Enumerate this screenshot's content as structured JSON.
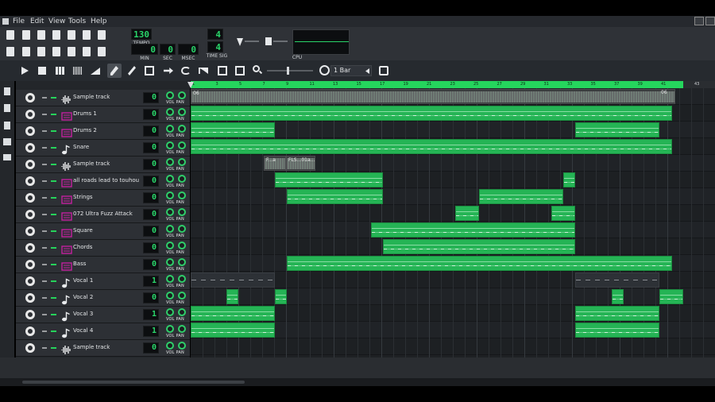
{
  "menu": {
    "items": [
      "File",
      "Edit",
      "View",
      "Tools",
      "Help"
    ]
  },
  "transport": {
    "tempo": "130",
    "tempo_label": "TEMPO",
    "min": "0",
    "sec": "0",
    "msec": "0",
    "min_label": "MIN",
    "sec_label": "SEC",
    "msec_label": "MSEC",
    "timesig_num": "4",
    "timesig_den": "4",
    "timesig_label": "TIME SIG",
    "cpu_label": "CPU"
  },
  "editor": {
    "quantize_value": "1 Bar"
  },
  "ruler": {
    "ticks": [
      "1",
      "3",
      "5",
      "7",
      "9",
      "11",
      "13",
      "15",
      "17",
      "19",
      "21",
      "23",
      "25",
      "27",
      "29",
      "31",
      "33",
      "35",
      "37",
      "39",
      "41",
      "43"
    ]
  },
  "tracks": [
    {
      "name": "Sample track",
      "volume": "0",
      "icon": "waveform-icon",
      "name_color": "#e4e6e8"
    },
    {
      "name": "Drums 1",
      "volume": "0",
      "icon": "plugin-icon",
      "name_color": "#e4e6e8"
    },
    {
      "name": "Drums 2",
      "volume": "0",
      "icon": "plugin-icon",
      "name_color": "#e4e6e8"
    },
    {
      "name": "Snare",
      "volume": "0",
      "icon": "note-icon",
      "name_color": "#e4e6e8"
    },
    {
      "name": "Sample track",
      "volume": "0",
      "icon": "waveform-icon",
      "name_color": "#e4e6e8"
    },
    {
      "name": "all roads lead to touhou",
      "volume": "0",
      "icon": "plugin-icon",
      "name_color": "#e4e6e8"
    },
    {
      "name": "Strings",
      "volume": "0",
      "icon": "plugin-icon",
      "name_color": "#e4e6e8"
    },
    {
      "name": "072 Ultra Fuzz Attack",
      "volume": "0",
      "icon": "plugin-icon",
      "name_color": "#e4e6e8"
    },
    {
      "name": "Square",
      "volume": "0",
      "icon": "plugin-icon",
      "name_color": "#e4e6e8"
    },
    {
      "name": "Chords",
      "volume": "0",
      "icon": "plugin-icon",
      "name_color": "#e4e6e8"
    },
    {
      "name": "Bass",
      "volume": "0",
      "icon": "plugin-icon",
      "name_color": "#e4e6e8"
    },
    {
      "name": "Vocal 1",
      "volume": "1",
      "icon": "note-icon",
      "name_color": "#e4e6e8"
    },
    {
      "name": "Vocal 2",
      "volume": "0",
      "icon": "note-icon",
      "name_color": "#e4e6e8"
    },
    {
      "name": "Vocal 3",
      "volume": "1",
      "icon": "note-icon",
      "name_color": "#e4e6e8"
    },
    {
      "name": "Vocal 4",
      "volume": "1",
      "icon": "note-icon",
      "name_color": "#e4e6e8"
    },
    {
      "name": "Sample track",
      "volume": "0",
      "icon": "waveform-icon",
      "name_color": "#e4e6e8"
    }
  ],
  "clip_labels": {
    "sample_a": "06",
    "sample_b": "06",
    "clip_f": "F...a",
    "clip_fls": "FLS...01a..."
  },
  "vol_pan_label": "VOL PAN",
  "colors": {
    "accent": "#25b455",
    "ruler": "#25d55d",
    "lcd_text": "#29d469"
  }
}
